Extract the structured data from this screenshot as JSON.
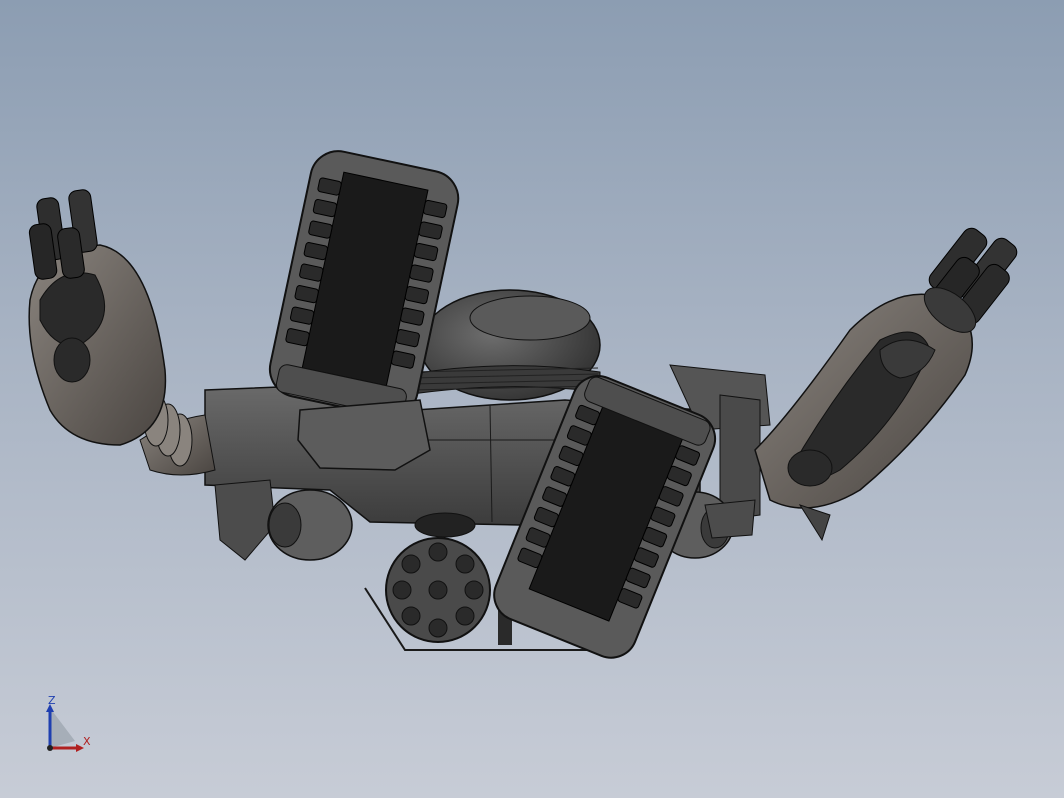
{
  "viewport": {
    "background_top": "#8c9db2",
    "background_bottom": "#c7ccd6",
    "model": "robot-mech-assembly"
  },
  "triad": {
    "z_label": "Z",
    "x_label": "X",
    "z_color": "#1f3fb0",
    "x_color": "#b02020"
  },
  "model_colors": {
    "body": "#5a5a5a",
    "dark": "#1e1e1e",
    "arm": "#6e6863",
    "edge": "#111111"
  }
}
